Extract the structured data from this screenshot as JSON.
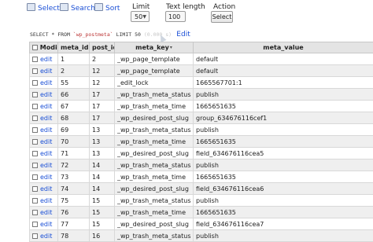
{
  "toolbar": {
    "select_label": "Select",
    "search_label": "Search",
    "sort_label": "Sort",
    "limit_label": "Limit",
    "limit_value": "50",
    "text_length_label": "Text length",
    "text_length_value": "100",
    "action_label": "Action",
    "action_button": "Select"
  },
  "query": {
    "prefix": "SELECT * FROM",
    "table": "`wp_postmeta`",
    "suffix": "LIMIT 50",
    "time": "(0.000 s)",
    "edit_label": "Edit"
  },
  "columns": {
    "modify": "Modify",
    "meta_id": "meta_id",
    "post_id": "post_id",
    "meta_key": "meta_key",
    "meta_value": "meta_value"
  },
  "row_edit_label": "edit",
  "rows": [
    {
      "meta_id": "1",
      "post_id": "2",
      "meta_key": "_wp_page_template",
      "meta_value": "default"
    },
    {
      "meta_id": "2",
      "post_id": "12",
      "meta_key": "_wp_page_template",
      "meta_value": "default"
    },
    {
      "meta_id": "55",
      "post_id": "12",
      "meta_key": "_edit_lock",
      "meta_value": "1665567701:1"
    },
    {
      "meta_id": "66",
      "post_id": "17",
      "meta_key": "_wp_trash_meta_status",
      "meta_value": "publish"
    },
    {
      "meta_id": "67",
      "post_id": "17",
      "meta_key": "_wp_trash_meta_time",
      "meta_value": "1665651635"
    },
    {
      "meta_id": "68",
      "post_id": "17",
      "meta_key": "_wp_desired_post_slug",
      "meta_value": "group_634676116cef1"
    },
    {
      "meta_id": "69",
      "post_id": "13",
      "meta_key": "_wp_trash_meta_status",
      "meta_value": "publish"
    },
    {
      "meta_id": "70",
      "post_id": "13",
      "meta_key": "_wp_trash_meta_time",
      "meta_value": "1665651635"
    },
    {
      "meta_id": "71",
      "post_id": "13",
      "meta_key": "_wp_desired_post_slug",
      "meta_value": "field_634676116cea5"
    },
    {
      "meta_id": "72",
      "post_id": "14",
      "meta_key": "_wp_trash_meta_status",
      "meta_value": "publish"
    },
    {
      "meta_id": "73",
      "post_id": "14",
      "meta_key": "_wp_trash_meta_time",
      "meta_value": "1665651635"
    },
    {
      "meta_id": "74",
      "post_id": "14",
      "meta_key": "_wp_desired_post_slug",
      "meta_value": "field_634676116cea6"
    },
    {
      "meta_id": "75",
      "post_id": "15",
      "meta_key": "_wp_trash_meta_status",
      "meta_value": "publish"
    },
    {
      "meta_id": "76",
      "post_id": "15",
      "meta_key": "_wp_trash_meta_time",
      "meta_value": "1665651635"
    },
    {
      "meta_id": "77",
      "post_id": "15",
      "meta_key": "_wp_desired_post_slug",
      "meta_value": "field_634676116cea7"
    },
    {
      "meta_id": "78",
      "post_id": "16",
      "meta_key": "_wp_trash_meta_status",
      "meta_value": "publish"
    }
  ]
}
